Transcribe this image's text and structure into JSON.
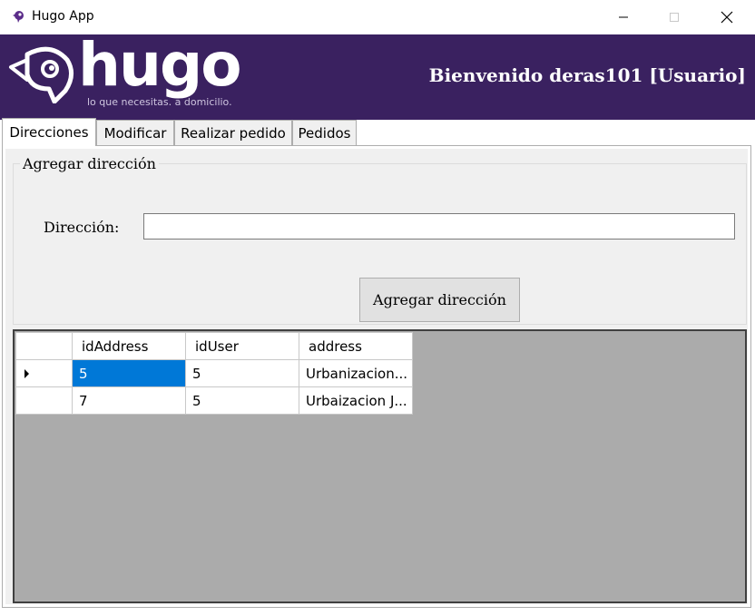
{
  "window": {
    "title": "Hugo App"
  },
  "header": {
    "logo_text": "hugo",
    "tagline": "lo que necesitas. a domicilio.",
    "welcome": "Bienvenido deras101 [Usuario]",
    "background_color": "#3a2160"
  },
  "tabs": [
    {
      "label": "Direcciones",
      "active": true
    },
    {
      "label": "Modificar",
      "active": false
    },
    {
      "label": "Realizar pedido",
      "active": false
    },
    {
      "label": "Pedidos",
      "active": false
    }
  ],
  "add_address": {
    "group_title": "Agregar dirección",
    "field_label": "Dirección:",
    "field_value": "",
    "button_label": "Agregar dirección"
  },
  "grid": {
    "columns": [
      "idAddress",
      "idUser",
      "address"
    ],
    "rows": [
      {
        "idAddress": "5",
        "idUser": "5",
        "address": "Urbanizacion...",
        "current": true
      },
      {
        "idAddress": "7",
        "idUser": "5",
        "address": "Urbaizacion J...",
        "current": false
      }
    ],
    "selection_color": "#0078d7"
  }
}
